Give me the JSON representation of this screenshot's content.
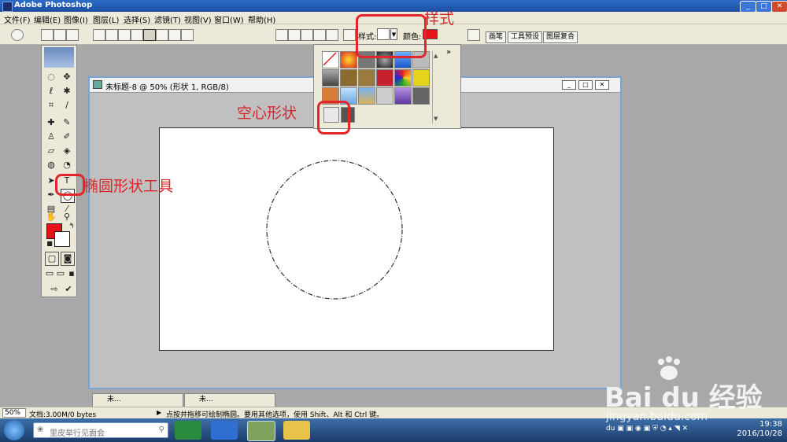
{
  "window": {
    "title": "Adobe Photoshop"
  },
  "menubar": [
    "文件(F)",
    "编辑(E)",
    "图像(I)",
    "图层(L)",
    "选择(S)",
    "滤镜(T)",
    "视图(V)",
    "窗口(W)",
    "帮助(H)"
  ],
  "options": {
    "style_label": "样式:",
    "color_label": "颜色:",
    "color": "#e6121a"
  },
  "palette_tabs": [
    "画笔",
    "工具预设",
    "图层复合"
  ],
  "document": {
    "title": "未标题-8 @ 50% (形状 1, RGB/8)"
  },
  "doc_tabs": [
    "未...",
    "未..."
  ],
  "status": {
    "zoom": "50%",
    "doc_info": "文档:3.00M/0 bytes",
    "hint": "点按并拖移可绘制椭圆。要用其他选项，使用 Shift、Alt 和 Ctrl 键。"
  },
  "taskbar": {
    "search_placeholder": "里皮举行见面会",
    "time": "19:38",
    "date": "2016/10/28"
  },
  "annotations": {
    "style": "样式",
    "hollow": "空心形状",
    "ellipse_tool": "椭圆形状工具"
  },
  "watermark": {
    "brand": "Bai du 经验",
    "url": "jingyan.baidu.com"
  },
  "colors": {
    "accent": "#e3262b",
    "foreground": "#e6121a",
    "background": "#ffffff"
  }
}
